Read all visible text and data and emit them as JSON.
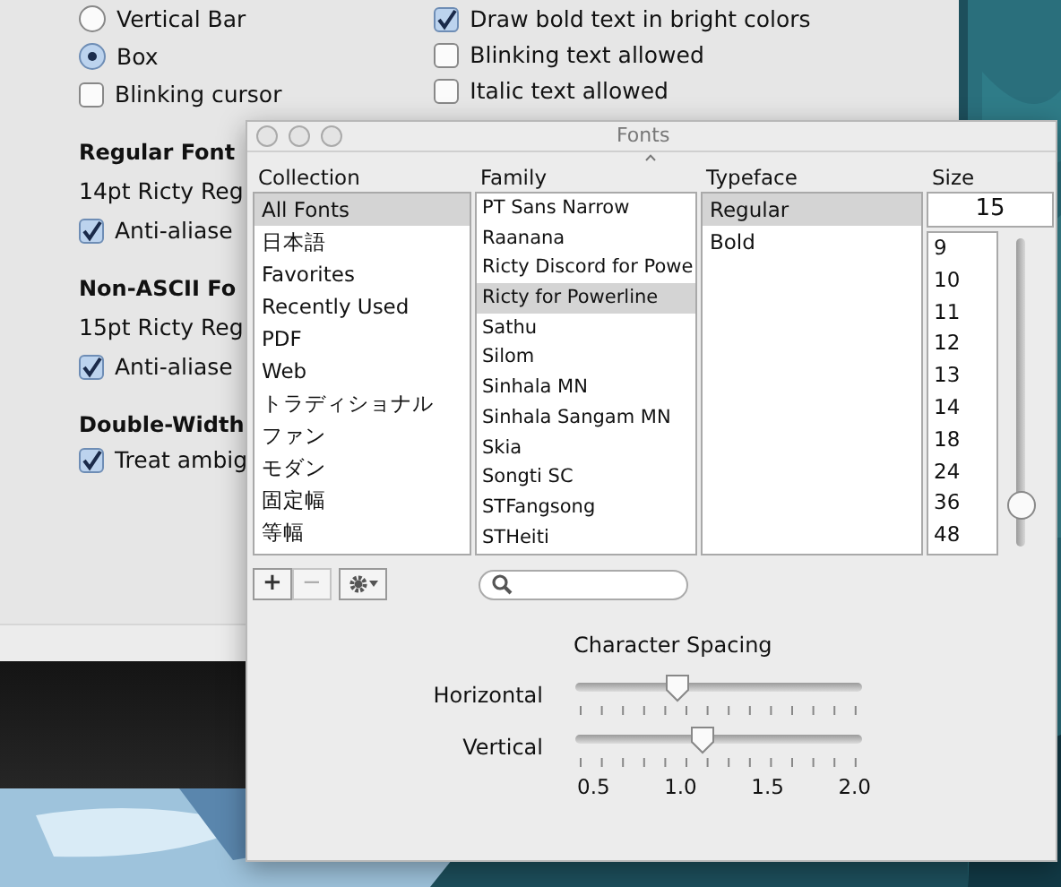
{
  "preferences": {
    "cursor_options": [
      {
        "label": "Vertical Bar",
        "selected": false
      },
      {
        "label": "Box",
        "selected": true
      }
    ],
    "blinking_cursor": {
      "label": "Blinking cursor",
      "checked": false
    },
    "text_options": [
      {
        "label": "Draw bold text in bright colors",
        "checked": true
      },
      {
        "label": "Blinking text allowed",
        "checked": false
      },
      {
        "label": "Italic text allowed",
        "checked": false
      }
    ],
    "sections": [
      {
        "heading": "Regular Font",
        "font": "14pt Ricty Reg",
        "checkbox": {
          "label": "Anti-aliase",
          "checked": true
        }
      },
      {
        "heading": "Non-ASCII Fo",
        "font": "15pt Ricty Reg",
        "checkbox": {
          "label": "Anti-aliase",
          "checked": true
        }
      },
      {
        "heading": "Double-Width",
        "checkbox": {
          "label": "Treat ambig",
          "checked": true
        }
      }
    ]
  },
  "fonts_panel": {
    "title": "Fonts",
    "headers": [
      "Collection",
      "Family",
      "Typeface",
      "Size"
    ],
    "collections": [
      {
        "label": "All Fonts",
        "selected": true
      },
      {
        "label": "日本語",
        "selected": false
      },
      {
        "label": "Favorites",
        "selected": false
      },
      {
        "label": "Recently Used",
        "selected": false
      },
      {
        "label": "PDF",
        "selected": false
      },
      {
        "label": "Web",
        "selected": false
      },
      {
        "label": "トラディショナル",
        "selected": false
      },
      {
        "label": "ファン",
        "selected": false
      },
      {
        "label": "モダン",
        "selected": false
      },
      {
        "label": "固定幅",
        "selected": false
      },
      {
        "label": "等幅",
        "selected": false
      }
    ],
    "families": [
      {
        "label": "PT Sans Narrow",
        "selected": false
      },
      {
        "label": "Raanana",
        "selected": false
      },
      {
        "label": "Ricty Discord for Powe",
        "selected": false
      },
      {
        "label": "Ricty for Powerline",
        "selected": true
      },
      {
        "label": "Sathu",
        "selected": false
      },
      {
        "label": "Silom",
        "selected": false
      },
      {
        "label": "Sinhala MN",
        "selected": false
      },
      {
        "label": "Sinhala Sangam MN",
        "selected": false
      },
      {
        "label": "Skia",
        "selected": false
      },
      {
        "label": "Songti SC",
        "selected": false
      },
      {
        "label": "STFangsong",
        "selected": false
      },
      {
        "label": "STHeiti",
        "selected": false
      }
    ],
    "typefaces": [
      {
        "label": "Regular",
        "selected": true
      },
      {
        "label": "Bold",
        "selected": false
      }
    ],
    "size": {
      "value": "15",
      "options": [
        "9",
        "10",
        "11",
        "12",
        "13",
        "14",
        "18",
        "24",
        "36",
        "48"
      ],
      "level": 0.1
    },
    "action_buttons": [
      {
        "label": "+",
        "disabled": false
      },
      {
        "label": "−",
        "disabled": true
      }
    ],
    "character_spacing": {
      "title": "Character Spacing",
      "sliders": [
        {
          "label": "Horizontal",
          "level": 0.34
        },
        {
          "label": "Vertical",
          "level": 0.44
        }
      ],
      "scale": [
        "0.5",
        "1.0",
        "1.5",
        "2.0"
      ]
    }
  }
}
